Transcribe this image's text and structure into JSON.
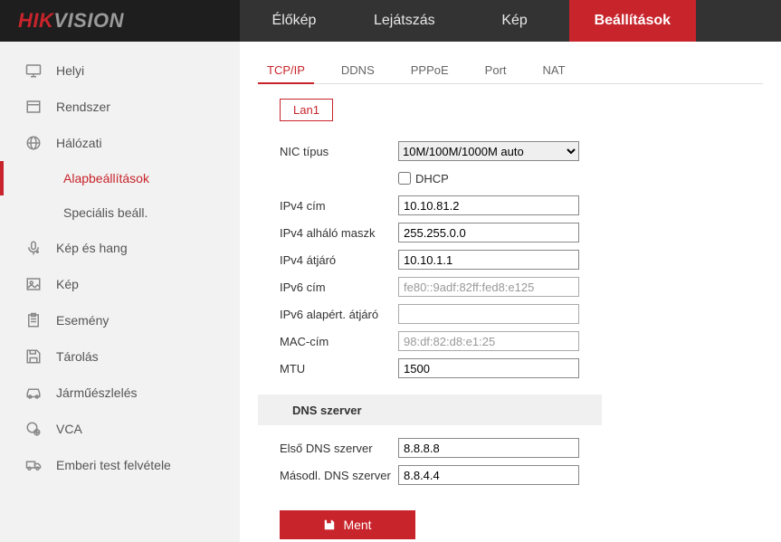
{
  "logo": {
    "hik": "HIK",
    "vision": "VISION"
  },
  "topnav": {
    "items": [
      {
        "label": "Élőkép"
      },
      {
        "label": "Lejátszás"
      },
      {
        "label": "Kép"
      },
      {
        "label": "Beállítások"
      }
    ]
  },
  "sidebar": {
    "items": [
      {
        "label": "Helyi"
      },
      {
        "label": "Rendszer"
      },
      {
        "label": "Hálózati"
      },
      {
        "label": "Kép és hang"
      },
      {
        "label": "Kép"
      },
      {
        "label": "Esemény"
      },
      {
        "label": "Tárolás"
      },
      {
        "label": "Járműészlelés"
      },
      {
        "label": "VCA"
      },
      {
        "label": "Emberi test felvétele"
      }
    ],
    "subitems": [
      {
        "label": "Alapbeállítások"
      },
      {
        "label": "Speciális beáll."
      }
    ]
  },
  "tabs": [
    {
      "label": "TCP/IP"
    },
    {
      "label": "DDNS"
    },
    {
      "label": "PPPoE"
    },
    {
      "label": "Port"
    },
    {
      "label": "NAT"
    }
  ],
  "subtab": {
    "label": "Lan1"
  },
  "form": {
    "nic_type_label": "NIC típus",
    "nic_type_value": "10M/100M/1000M auto",
    "dhcp_label": "DHCP",
    "ipv4_addr_label": "IPv4 cím",
    "ipv4_addr_value": "10.10.81.2",
    "ipv4_mask_label": "IPv4 alháló maszk",
    "ipv4_mask_value": "255.255.0.0",
    "ipv4_gw_label": "IPv4 átjáró",
    "ipv4_gw_value": "10.10.1.1",
    "ipv6_addr_label": "IPv6 cím",
    "ipv6_addr_value": "fe80::9adf:82ff:fed8:e125",
    "ipv6_gw_label": "IPv6 alapért. átjáró",
    "ipv6_gw_value": "",
    "mac_label": "MAC-cím",
    "mac_value": "98:df:82:d8:e1:25",
    "mtu_label": "MTU",
    "mtu_value": "1500",
    "dns_section": "DNS szerver",
    "dns1_label": "Első DNS szerver",
    "dns1_value": "8.8.8.8",
    "dns2_label": "Másodl. DNS szerver",
    "dns2_value": "8.8.4.4"
  },
  "save_button": "Ment"
}
